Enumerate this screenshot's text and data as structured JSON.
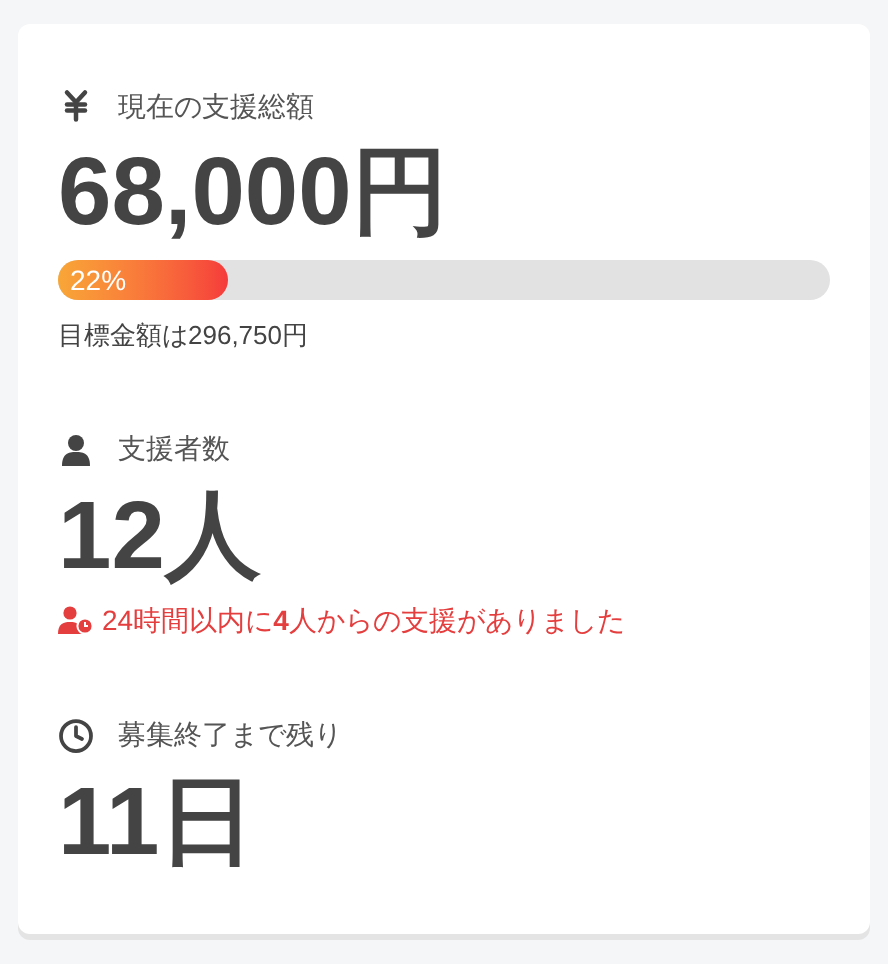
{
  "sections": [
    {
      "kind": "amount",
      "label": "現在の支援総額",
      "value": "68,000円",
      "progress": {
        "level": 0.22,
        "label": "22%"
      },
      "goal": "目標金額は296,750円"
    },
    {
      "kind": "supporters",
      "label": "支援者数",
      "value": "12人",
      "note": "24時間以内に**4**人からの支援がありました"
    },
    {
      "kind": "remaining",
      "label": "募集終了まで残り",
      "value": "11日"
    }
  ]
}
